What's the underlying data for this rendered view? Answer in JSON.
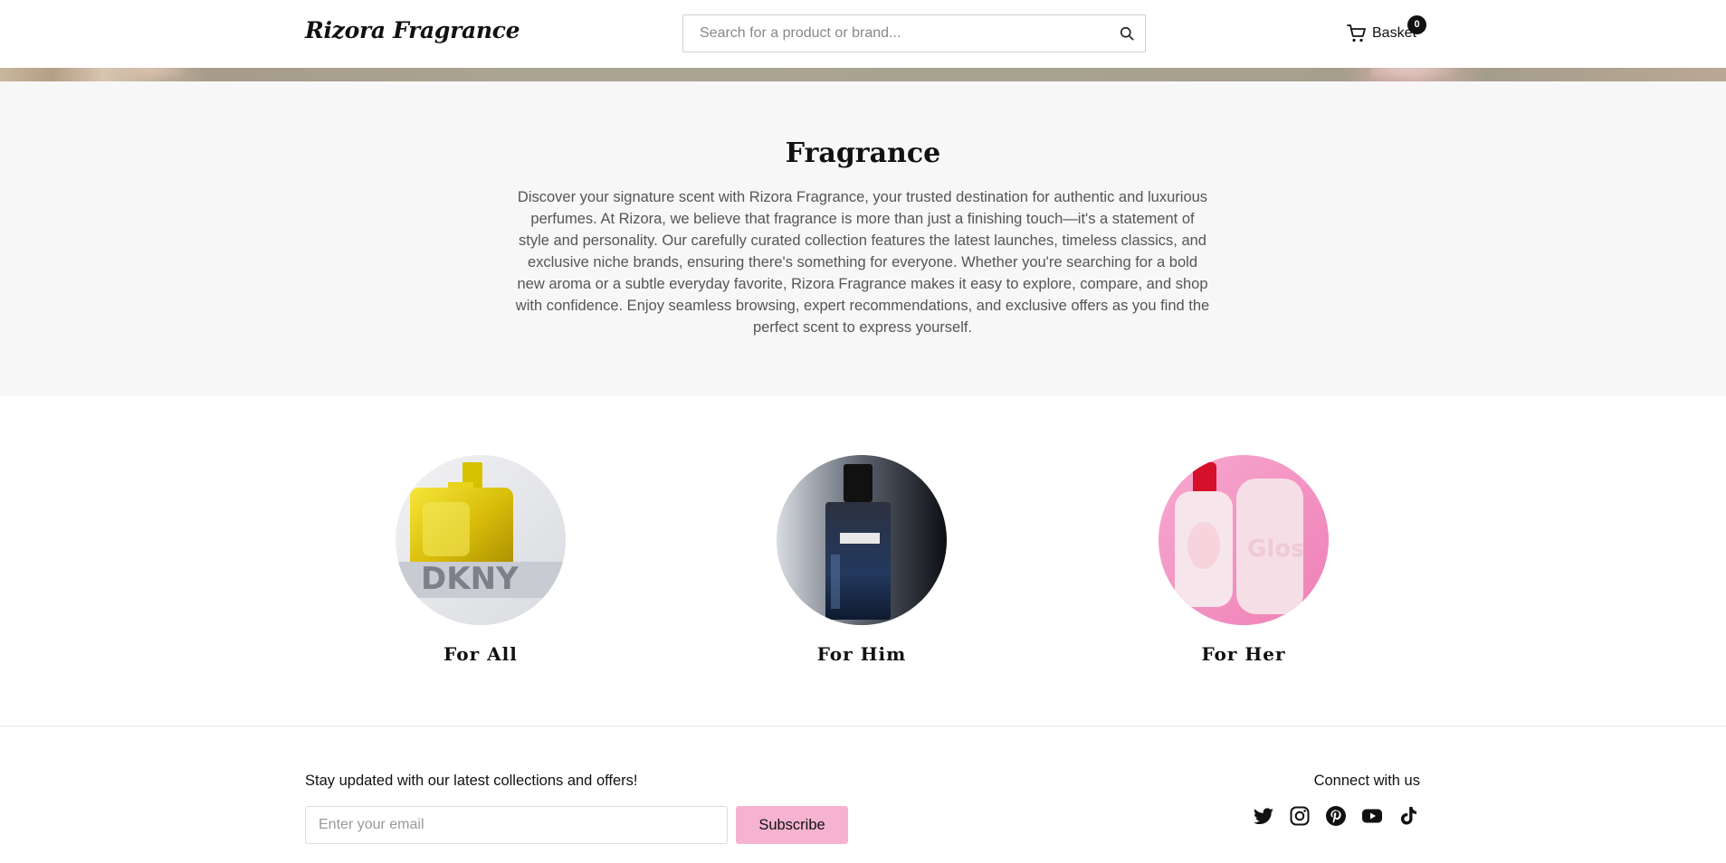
{
  "header": {
    "logo": "Rizora Fragrance",
    "search_placeholder": "Search for a product or brand...",
    "basket_label": "Basket",
    "basket_count": "0"
  },
  "intro": {
    "title": "Fragrance",
    "description": "Discover your signature scent with Rizora Fragrance, your trusted destination for authentic and luxurious perfumes. At Rizora, we believe that fragrance is more than just a finishing touch—it's a statement of style and personality. Our carefully curated collection features the latest launches, timeless classics, and exclusive niche brands, ensuring there's something for everyone. Whether you're searching for a bold new aroma or a subtle everyday favorite, Rizora Fragrance makes it easy to explore, compare, and shop with confidence. Enjoy seamless browsing, expert recommendations, and exclusive offers as you find the perfect scent to express yourself."
  },
  "categories": [
    {
      "label": "For All",
      "image": "yellow-perfume-bottle"
    },
    {
      "label": "For Him",
      "image": "dark-blue-perfume-bottle"
    },
    {
      "label": "For Her",
      "image": "pink-perfume-bottles"
    }
  ],
  "footer": {
    "newsletter_text": "Stay updated with our latest collections and offers!",
    "email_placeholder": "Enter your email",
    "subscribe_label": "Subscribe",
    "connect_label": "Connect with us",
    "socials": [
      "twitter-icon",
      "instagram-icon",
      "pinterest-icon",
      "youtube-icon",
      "tiktok-icon"
    ]
  },
  "colors": {
    "subscribe_button": "#f5b3d0",
    "intro_background": "#f7f7f7",
    "body_text_muted": "#555555"
  }
}
